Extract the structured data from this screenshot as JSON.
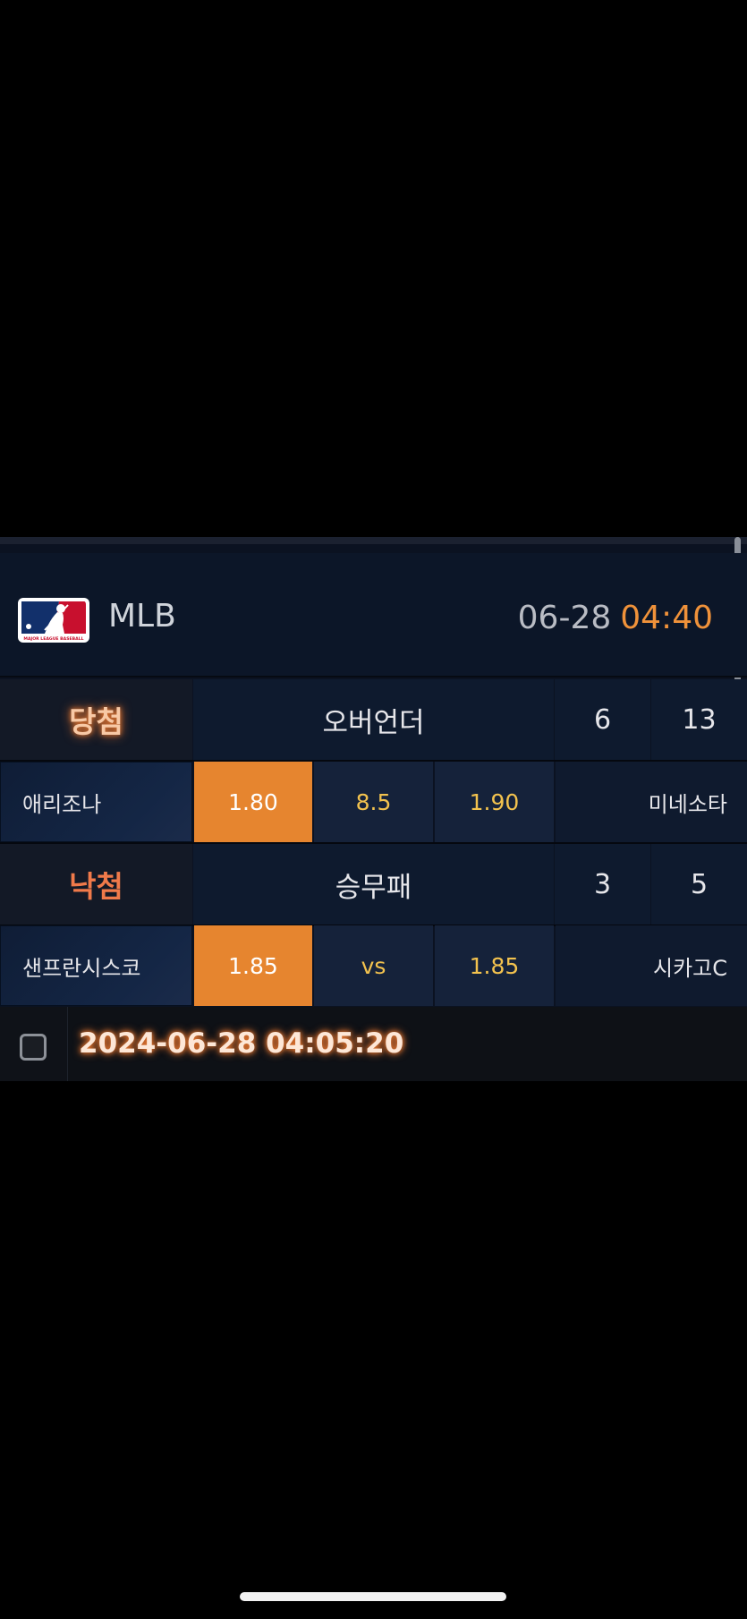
{
  "header": {
    "league": "MLB",
    "date": "06-28",
    "time": "04:40",
    "logo_text": "MAJOR LEAGUE BASEBALL"
  },
  "bets": [
    {
      "status": "당첨",
      "market": "오버언더",
      "num1": "6",
      "num2": "13",
      "home_team": "애리조나",
      "odds_home": "1.80",
      "middle": "8.5",
      "odds_away": "1.90",
      "away_team": "미네소타"
    },
    {
      "status": "낙첨",
      "market": "승무패",
      "num1": "3",
      "num2": "5",
      "home_team": "샌프란시스코",
      "odds_home": "1.85",
      "middle": "vs",
      "odds_away": "1.85",
      "away_team": "시카고C"
    }
  ],
  "footer": {
    "timestamp": "2024-06-28 04:05:20"
  },
  "colors": {
    "accent_orange": "#e6852f",
    "time_orange": "#f0923a",
    "odds_yellow": "#f2c24e",
    "panel_bg": "#0b1221"
  }
}
